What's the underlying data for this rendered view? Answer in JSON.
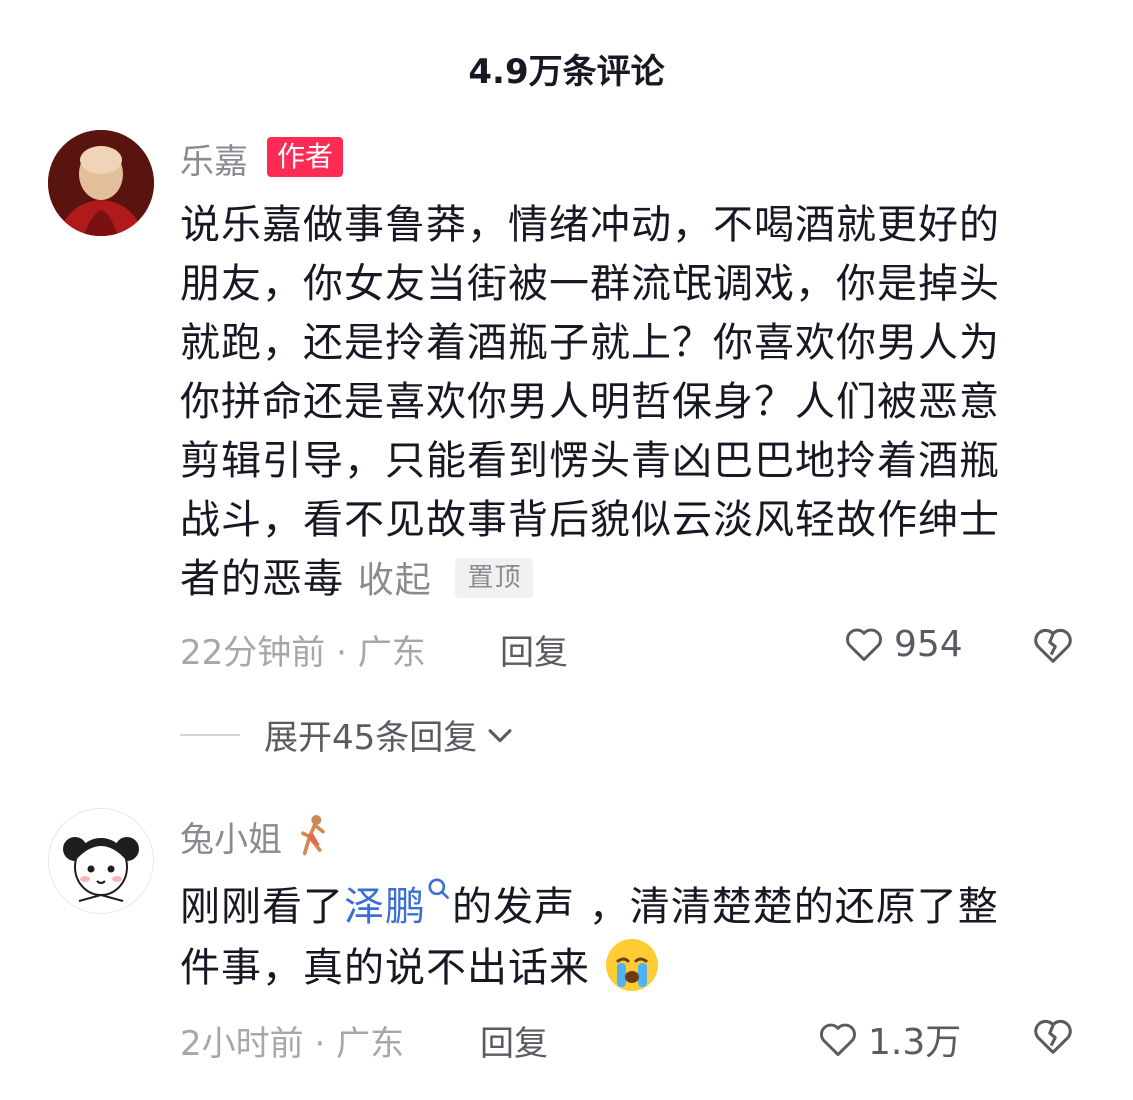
{
  "header": {
    "title": "4.9万条评论"
  },
  "comments": [
    {
      "username": "乐嘉",
      "badge": "作者",
      "text_lines": [
        "说乐嘉做事鲁莽，情绪冲动，不喝酒就更好的",
        "朋友，你女友当街被一群流氓调戏，你是掉头",
        "就跑，还是拎着酒瓶子就上？你喜欢你男人为",
        "你拼命还是喜欢你男人明哲保身？人们被恶意",
        "剪辑引导，只能看到愣头青凶巴巴地拎着酒瓶",
        "战斗，看不见故事背后貌似云淡风轻故作绅士",
        "者的恶毒"
      ],
      "collapse_label": "收起",
      "pin_label": "置顶",
      "time": "22分钟前",
      "location": "广东",
      "reply_label": "回复",
      "likes": "954",
      "expand_label": "展开45条回复"
    },
    {
      "username": "兔小姐",
      "text_before": "刚刚看了",
      "hashtag": "泽鹏",
      "text_after_line1": "的发声 ，清清楚楚的还原了整",
      "text_line2": "件事，真的说不出话来",
      "emoji": "😭",
      "time": "2小时前",
      "location": "广东",
      "reply_label": "回复",
      "likes": "1.3万"
    }
  ],
  "colors": {
    "accent": "#fe2c55",
    "link": "#3b6fd6",
    "text": "#161823",
    "muted": "#8a8b91"
  },
  "icons": [
    "heart-outline-icon",
    "broken-heart-icon",
    "chevron-down-icon",
    "search-icon",
    "dancer-emoji-icon",
    "crying-emoji-icon"
  ]
}
